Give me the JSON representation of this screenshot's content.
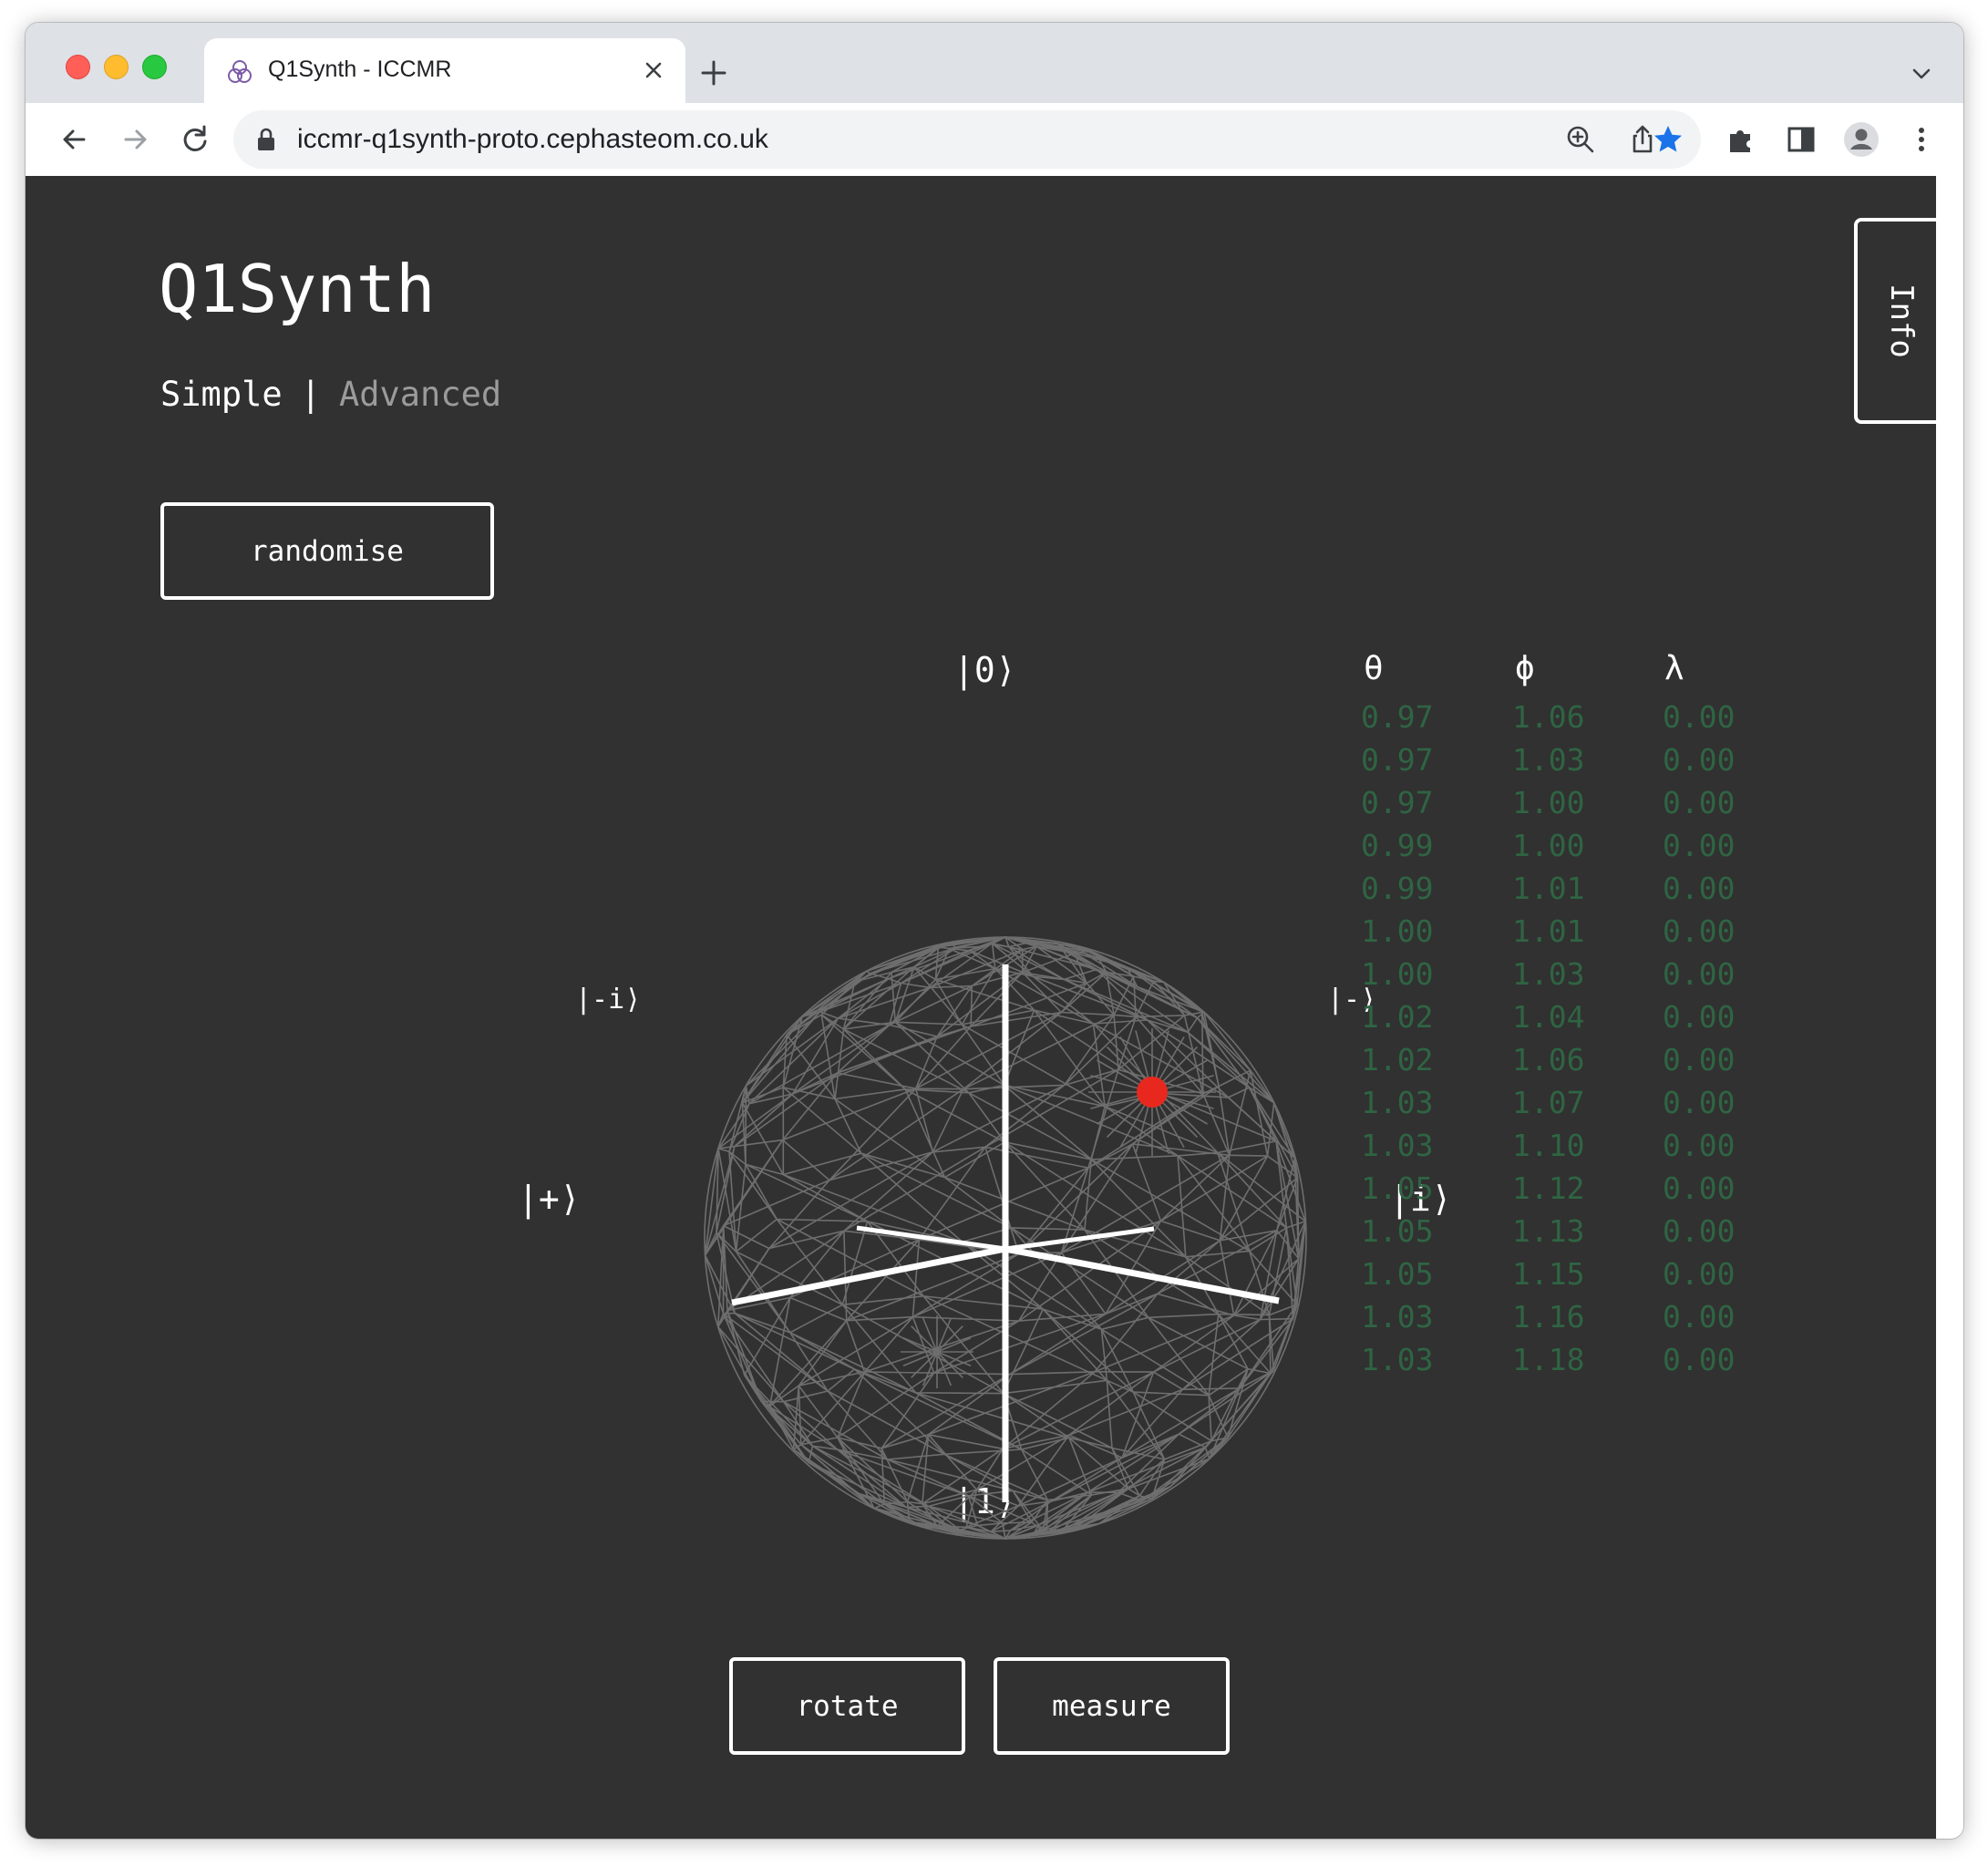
{
  "browser": {
    "tab_title": "Q1Synth - ICCMR",
    "url": "iccmr-q1synth-proto.cephasteom.co.uk",
    "icons": [
      "tab-favicon-icon",
      "close-icon",
      "plus-icon",
      "chevron-down-icon",
      "back-arrow-icon",
      "forward-arrow-icon",
      "reload-icon",
      "lock-icon",
      "zoom-icon",
      "share-icon",
      "star-icon",
      "puzzle-icon",
      "sidebar-icon",
      "profile-icon",
      "kebab-menu-icon"
    ],
    "colors": {
      "tabstrip": "#dee1e6",
      "star": "#1a73e8"
    }
  },
  "app": {
    "title": "Q1Synth",
    "mode_simple": "Simple",
    "mode_separator": "|",
    "mode_advanced": "Advanced",
    "randomise_label": "randomise",
    "rotate_label": "rotate",
    "measure_label": "measure",
    "info_label": "Info",
    "colors": {
      "background": "#313131",
      "history_text": "#2f6443",
      "state_point": "#e8281e",
      "wireframe": "#6e6e6e"
    }
  },
  "bloch": {
    "ket_0": "|0⟩",
    "ket_1": "|1⟩",
    "ket_minus_i": "|-i⟩",
    "ket_minus": "|-⟩",
    "ket_plus": "|+⟩",
    "ket_i": "|i⟩"
  },
  "history": {
    "headers": {
      "theta": "θ",
      "phi": "ϕ",
      "lambda": "λ"
    },
    "theta": [
      "0.97",
      "0.97",
      "0.97",
      "0.99",
      "0.99",
      "1.00",
      "1.00",
      "1.02",
      "1.02",
      "1.03",
      "1.03",
      "1.05",
      "1.05",
      "1.05",
      "1.03",
      "1.03"
    ],
    "phi": [
      "1.06",
      "1.03",
      "1.00",
      "1.00",
      "1.01",
      "1.01",
      "1.03",
      "1.04",
      "1.06",
      "1.07",
      "1.10",
      "1.12",
      "1.13",
      "1.15",
      "1.16",
      "1.18"
    ],
    "lambda": [
      "0.00",
      "0.00",
      "0.00",
      "0.00",
      "0.00",
      "0.00",
      "0.00",
      "0.00",
      "0.00",
      "0.00",
      "0.00",
      "0.00",
      "0.00",
      "0.00",
      "0.00",
      "0.00"
    ]
  }
}
